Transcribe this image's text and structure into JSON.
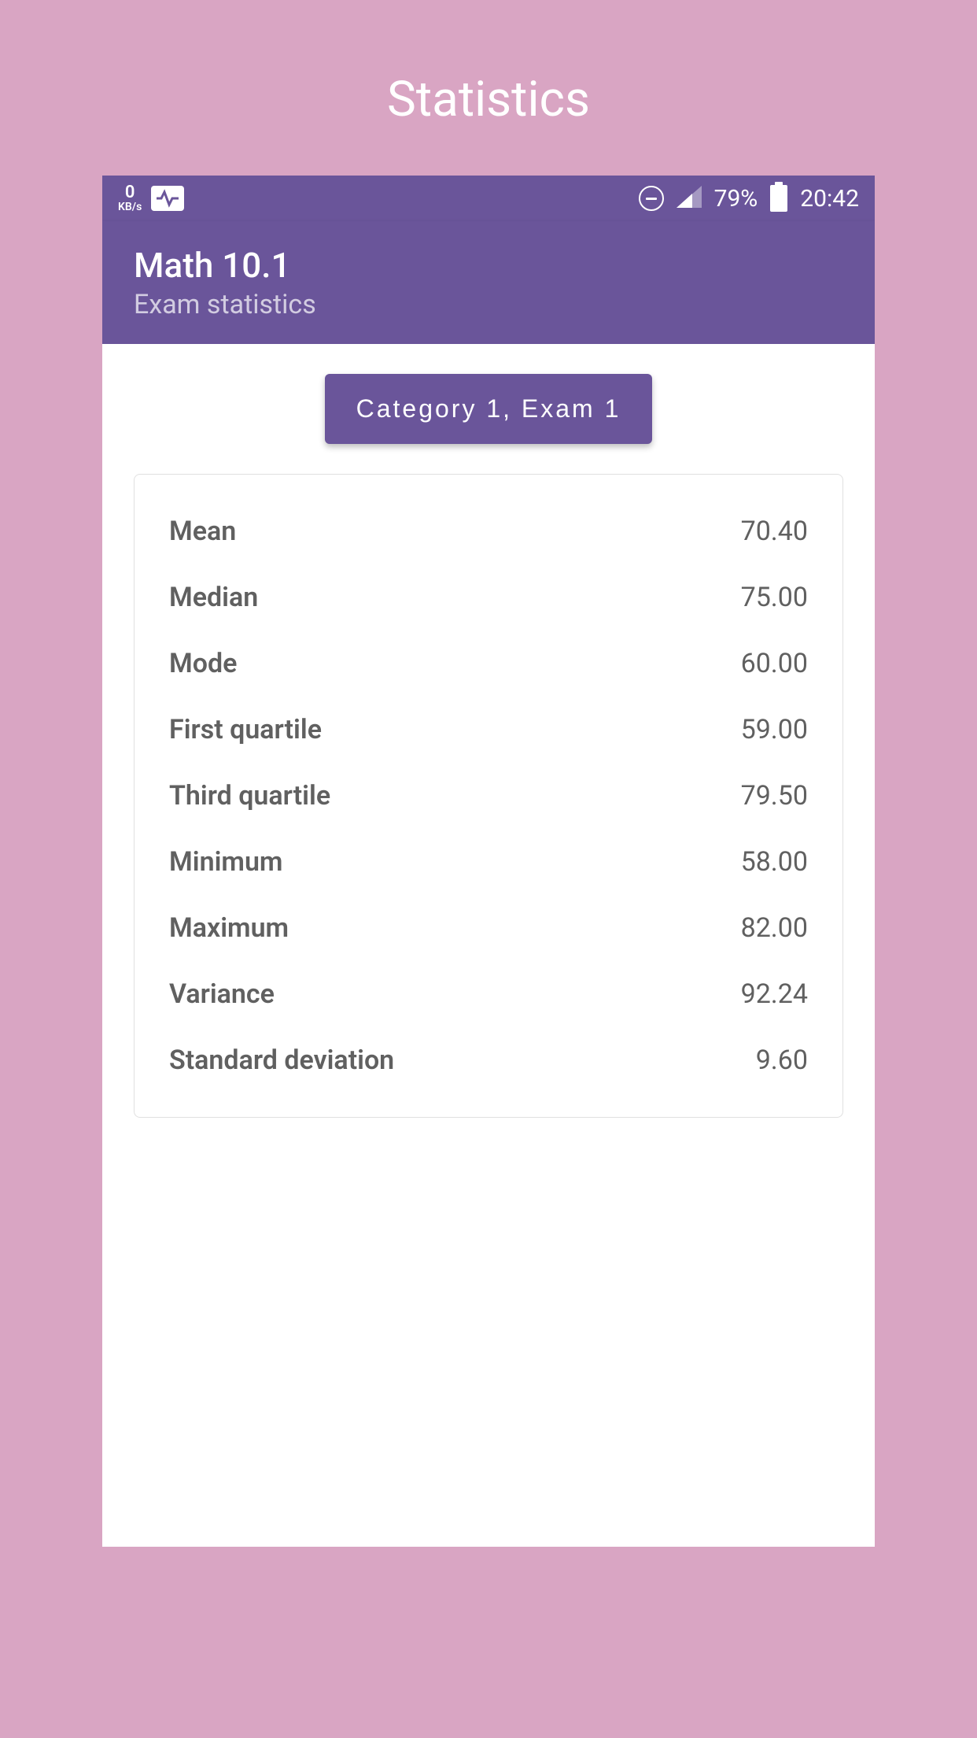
{
  "page": {
    "title": "Statistics"
  },
  "statusBar": {
    "kbSpeed": "0",
    "kbLabel": "KB/s",
    "batteryPercent": "79%",
    "time": "20:42"
  },
  "header": {
    "title": "Math 10.1",
    "subtitle": "Exam statistics"
  },
  "categoryButton": {
    "label": "Category 1, Exam 1"
  },
  "statistics": [
    {
      "label": "Mean",
      "value": "70.40"
    },
    {
      "label": "Median",
      "value": "75.00"
    },
    {
      "label": "Mode",
      "value": "60.00"
    },
    {
      "label": "First quartile",
      "value": "59.00"
    },
    {
      "label": "Third quartile",
      "value": "79.50"
    },
    {
      "label": "Minimum",
      "value": "58.00"
    },
    {
      "label": "Maximum",
      "value": "82.00"
    },
    {
      "label": "Variance",
      "value": "92.24"
    },
    {
      "label": "Standard deviation",
      "value": "9.60"
    }
  ]
}
